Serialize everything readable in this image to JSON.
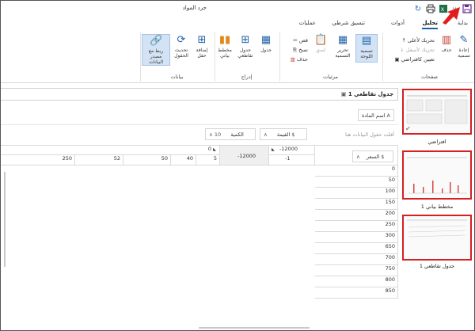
{
  "window": {
    "title": "جرد المواد"
  },
  "menu_tabs": [
    {
      "label": "بداية",
      "active": false
    },
    {
      "label": "تحليل",
      "active": true
    },
    {
      "label": "أدوات",
      "active": false
    },
    {
      "label": "تنسيق شرطي",
      "active": false
    },
    {
      "label": "عمليات",
      "active": false
    }
  ],
  "ribbon": {
    "pages_group": {
      "label": "صفحات",
      "edit_label": "إعادة تسمية",
      "delete_label": "حذف",
      "move_up": "تحريك لأعلى",
      "move_down": "تحريك لأسفل",
      "set_default": "تعيين كافتراضي"
    },
    "labels_group": {
      "label": "مرئيات",
      "layout_label": "تسمية اللوحة",
      "edit_label": "تحرير التسمية",
      "paste": "لصق",
      "cut": "قص",
      "copy": "نسخ",
      "delete": "حذف"
    },
    "insert_group": {
      "label": "إدراج",
      "table": "جدول",
      "pivot": "جدول تقاطعي",
      "chart": "مخطط بياني"
    },
    "data_group": {
      "label": "بيانات",
      "add_field": "إضافة حقل",
      "refresh_fields": "تحديث الحقول",
      "link_source": "ربط مع مصدر البيانات"
    }
  },
  "pages": [
    {
      "label": "افتراضي"
    },
    {
      "label": "مخطط بياني 1"
    },
    {
      "label": "جدول تقاطعي 1"
    }
  ],
  "pivot": {
    "title": "جدول تقاطعي 1",
    "filter_field": "اسم المادة",
    "filter_hint": "أفلت حقول البيانات هنا",
    "value_field_1": "القيمة",
    "value_field_2": "الكمية",
    "row_field": "السعر",
    "col_header_a": "-12000",
    "col_header_b": "0",
    "corner_a": "-12000",
    "corner_b": "-1",
    "col_values": [
      "5",
      "40",
      "50",
      "52",
      "250"
    ],
    "row_values": [
      "0",
      "50",
      "100",
      "150",
      "200",
      "250",
      "300",
      "650",
      "700",
      "750",
      "800",
      "850"
    ]
  },
  "colors": {
    "accent": "#1f5fa6",
    "highlight": "#d42020"
  },
  "icons": {
    "save": "save-icon",
    "refresh": "refresh-icon",
    "print": "print-icon",
    "excel": "excel-icon"
  }
}
